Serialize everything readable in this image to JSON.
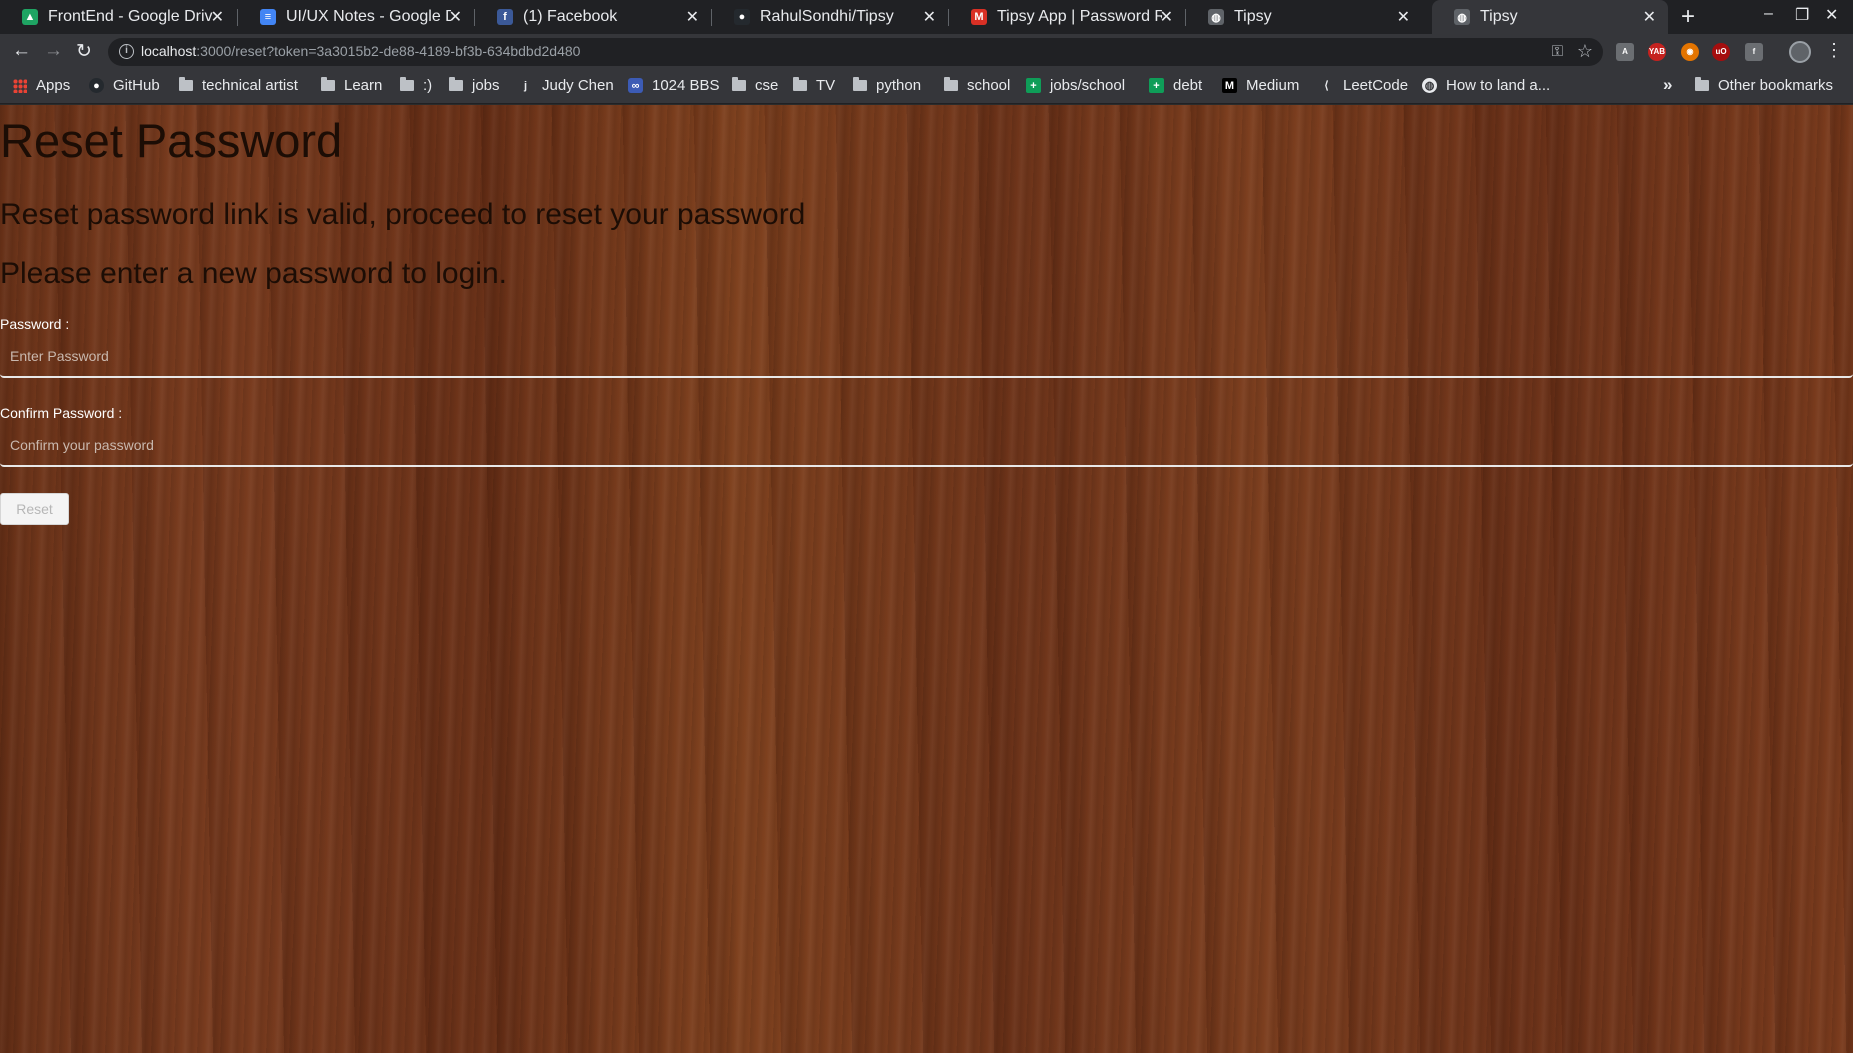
{
  "browser": {
    "tabs": [
      {
        "title": "FrontEnd - Google Drive",
        "icon": "google-drive-icon",
        "color": "#1fa463",
        "glyph": "▲",
        "active": false
      },
      {
        "title": "UI/UX Notes - Google Doc",
        "icon": "google-docs-icon",
        "color": "#4285f4",
        "glyph": "≡",
        "active": false
      },
      {
        "title": "(1) Facebook",
        "icon": "facebook-icon",
        "color": "#3b5998",
        "glyph": "f",
        "active": false
      },
      {
        "title": "RahulSondhi/Tipsy",
        "icon": "github-icon",
        "color": "#24292e",
        "glyph": "●",
        "active": false
      },
      {
        "title": "Tipsy App | Password Res",
        "icon": "gmail-icon",
        "color": "#d93025",
        "glyph": "M",
        "active": false
      },
      {
        "title": "Tipsy",
        "icon": "globe-icon",
        "color": "#5f6368",
        "glyph": "◍",
        "active": false
      },
      {
        "title": "Tipsy",
        "icon": "globe-icon",
        "color": "#5f6368",
        "glyph": "◍",
        "active": true
      }
    ],
    "new_tab": "+",
    "url_host": "localhost",
    "url_rest": ":3000/reset?token=3a3015b2-de88-4189-bf3b-634bdbd2d480",
    "bookmarks": [
      {
        "label": "Apps",
        "icon": "apps-icon"
      },
      {
        "label": "GitHub",
        "icon": "github-icon"
      },
      {
        "label": "technical artist",
        "icon": "folder-icon"
      },
      {
        "label": "Learn",
        "icon": "folder-icon"
      },
      {
        "label": ":)",
        "icon": "folder-icon"
      },
      {
        "label": "jobs",
        "icon": "folder-icon"
      },
      {
        "label": "Judy Chen",
        "icon": "j-icon"
      },
      {
        "label": "1024 BBS",
        "icon": "bbs-icon"
      },
      {
        "label": "cse",
        "icon": "folder-icon"
      },
      {
        "label": "TV",
        "icon": "folder-icon"
      },
      {
        "label": "python",
        "icon": "folder-icon"
      },
      {
        "label": "school",
        "icon": "folder-icon"
      },
      {
        "label": "jobs/school",
        "icon": "sheets-icon"
      },
      {
        "label": "debt",
        "icon": "sheets-icon"
      },
      {
        "label": "Medium",
        "icon": "medium-icon"
      },
      {
        "label": "LeetCode",
        "icon": "leetcode-icon"
      },
      {
        "label": "How to land a...",
        "icon": "globe-icon"
      }
    ],
    "other_bookmarks": "Other bookmarks"
  },
  "page": {
    "title": "Reset Password",
    "message_valid": "Reset password link is valid, proceed to reset your password",
    "message_enter": "Please enter a new password to login.",
    "password_label": "Password :",
    "password_placeholder": "Enter Password",
    "confirm_label": "Confirm Password :",
    "confirm_placeholder": "Confirm your password",
    "reset_button": "Reset"
  }
}
